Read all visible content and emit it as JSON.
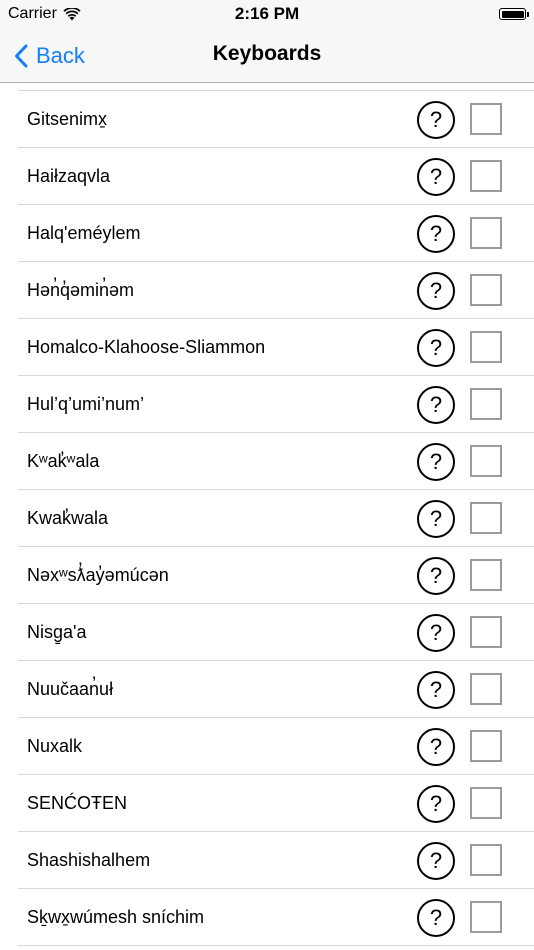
{
  "status_bar": {
    "carrier": "Carrier",
    "time": "2:16 PM",
    "wifi_icon": "wifi-icon",
    "battery_icon": "battery-icon"
  },
  "nav": {
    "back_label": "Back",
    "back_icon": "chevron-left-icon",
    "title": "Keyboards",
    "accent_color": "#157efb"
  },
  "keyboards": [
    {
      "label": "Gitsenimx̱",
      "help": "?",
      "checked": false
    },
    {
      "label": "Haiłzaqvla",
      "help": "?",
      "checked": false
    },
    {
      "label": "Halq'eméylem",
      "help": "?",
      "checked": false
    },
    {
      "label": "Hən̓q̓əmin̓əm",
      "help": "?",
      "checked": false
    },
    {
      "label": "Homalco-Klahoose-Sliammon",
      "help": "?",
      "checked": false
    },
    {
      "label": "Hul’q’umi’num’",
      "help": "?",
      "checked": false
    },
    {
      "label": "Kʷak̓ʷala",
      "help": "?",
      "checked": false
    },
    {
      "label": "Kwak̓wala",
      "help": "?",
      "checked": false
    },
    {
      "label": "Nəxʷsƛ̓ay̓əmúcən",
      "help": "?",
      "checked": false
    },
    {
      "label": "Nisg̱a'a",
      "help": "?",
      "checked": false
    },
    {
      "label": "Nuučaan̓uł",
      "help": "?",
      "checked": false
    },
    {
      "label": "Nuxalk",
      "help": "?",
      "checked": false
    },
    {
      "label": "SENĆOŦEN",
      "help": "?",
      "checked": false
    },
    {
      "label": "Shashishalhem",
      "help": "?",
      "checked": false
    },
    {
      "label": "Sḵwx̱wúmesh sníchim",
      "help": "?",
      "checked": false
    }
  ]
}
